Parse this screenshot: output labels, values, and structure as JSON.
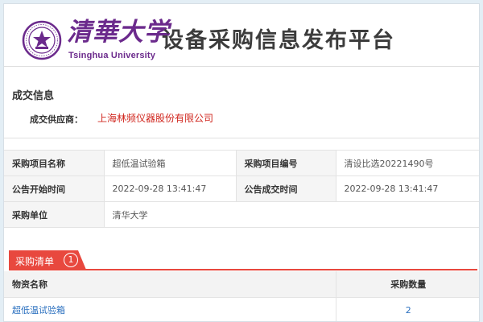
{
  "header": {
    "logo_cn": "清華大学",
    "logo_en": "Tsinghua University",
    "site_title": "设备采购信息发布平台"
  },
  "deal": {
    "heading": "成交信息",
    "supplier_label": "成交供应商：",
    "supplier_value": "上海林频仪器股份有限公司"
  },
  "info": {
    "rows": [
      {
        "label1": "采购项目名称",
        "value1": "超低温试验箱",
        "label2": "采购项目编号",
        "value2": "清设比选20221490号"
      },
      {
        "label1": "公告开始时间",
        "value1": "2022-09-28 13:41:47",
        "label2": "公告成交时间",
        "value2": "2022-09-28 13:41:47"
      },
      {
        "label1": "采购单位",
        "value1": "清华大学"
      }
    ]
  },
  "procurement_list": {
    "tab_label": "采购清单",
    "count": "1",
    "columns": [
      "物资名称",
      "采购数量"
    ],
    "items": [
      {
        "name": "超低温试验箱",
        "quantity": "2"
      }
    ]
  },
  "colors": {
    "accent_red": "#e8483e",
    "supplier_red": "#d0241c",
    "link_blue": "#2a6fbf",
    "logo_purple": "#6b2a8c",
    "page_bg": "#e3eef5"
  }
}
